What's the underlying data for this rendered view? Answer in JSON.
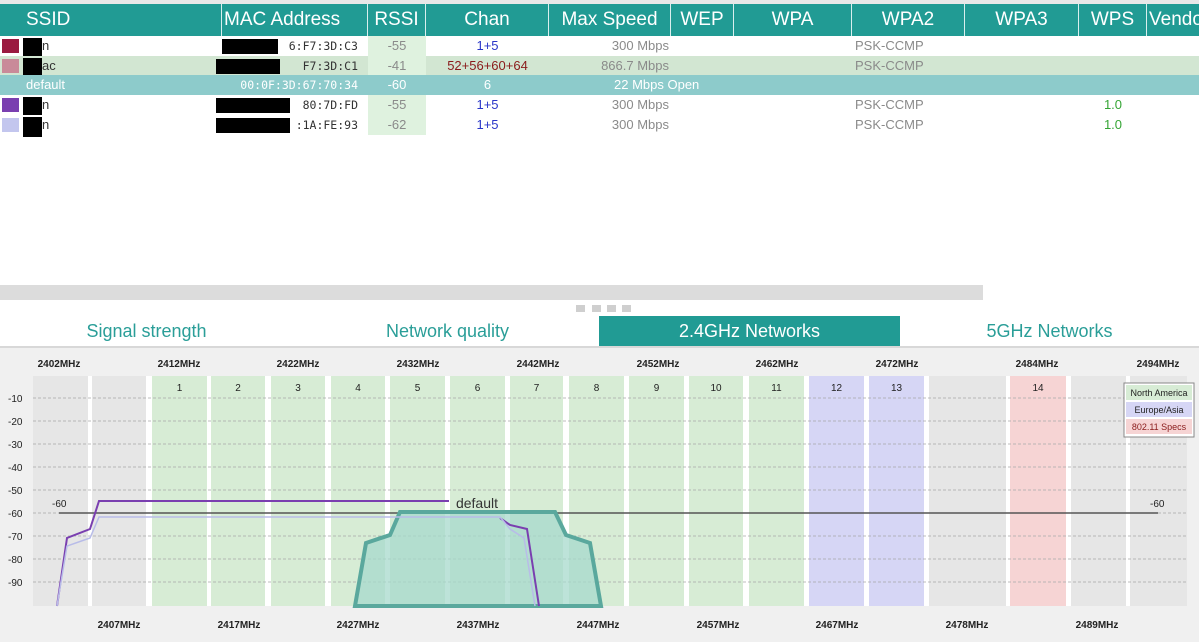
{
  "table": {
    "columns": [
      "SSID",
      "MAC Address",
      "RSSI",
      "Chan",
      "Max Speed",
      "WEP",
      "WPA",
      "WPA2",
      "WPA3",
      "WPS",
      "Vendor"
    ],
    "rows": [
      {
        "swatch": "#9a1a40",
        "ssid": "n",
        "mac": "6:F7:3D:C3",
        "rssi": "-55",
        "chan": "1+5",
        "speed": "300 Mbps",
        "wpa2": "PSK-CCMP",
        "wps": "",
        "redact": true,
        "bg": "#ffffff"
      },
      {
        "swatch": "#c98a99",
        "ssid": "ac",
        "mac": "F7:3D:C1",
        "rssi": "-41",
        "chan": "52+56+60+64",
        "speed": "866.7 Mbps",
        "wpa2": "PSK-CCMP",
        "wps": "",
        "redact": true,
        "bg": "#d2e6d2"
      },
      {
        "swatch": "",
        "ssid": "default",
        "mac": "00:0F:3D:67:70:34",
        "rssi": "-60",
        "chan": "6",
        "speed": "22 Mbps Open",
        "wpa2": "",
        "wps": "",
        "redact": false,
        "bg": "#8dcbcb"
      },
      {
        "swatch": "#7a3fb0",
        "ssid": "n",
        "mac": "80:7D:FD",
        "rssi": "-55",
        "chan": "1+5",
        "speed": "300 Mbps",
        "wpa2": "PSK-CCMP",
        "wps": "1.0",
        "redact": true,
        "bg": "#ffffff"
      },
      {
        "swatch": "#c3c6ee",
        "ssid": "n",
        "mac": ":1A:FE:93",
        "rssi": "-62",
        "chan": "1+5",
        "speed": "300 Mbps",
        "wpa2": "PSK-CCMP",
        "wps": "1.0",
        "redact": true,
        "bg": "#ffffff"
      }
    ]
  },
  "tabs": [
    {
      "label": "Signal strength",
      "active": false
    },
    {
      "label": "Network quality",
      "active": false
    },
    {
      "label": "2.4GHz Networks",
      "active": true
    },
    {
      "label": "5GHz Networks",
      "active": false
    }
  ],
  "chart_data": {
    "type": "spectrum",
    "top_freq_labels": [
      "2402MHz",
      "2412MHz",
      "2422MHz",
      "2432MHz",
      "2442MHz",
      "2452MHz",
      "2462MHz",
      "2472MHz",
      "2484MHz",
      "2494MHz"
    ],
    "bottom_freq_labels": [
      "2407MHz",
      "2417MHz",
      "2427MHz",
      "2437MHz",
      "2447MHz",
      "2457MHz",
      "2467MHz",
      "2478MHz",
      "2489MHz"
    ],
    "y_ticks": [
      -10,
      -20,
      -30,
      -40,
      -50,
      -60,
      -70,
      -80,
      -90
    ],
    "channels": [
      {
        "num": "1",
        "region": "na"
      },
      {
        "num": "2",
        "region": "na"
      },
      {
        "num": "3",
        "region": "na"
      },
      {
        "num": "4",
        "region": "na"
      },
      {
        "num": "5",
        "region": "na"
      },
      {
        "num": "6",
        "region": "na"
      },
      {
        "num": "7",
        "region": "na"
      },
      {
        "num": "8",
        "region": "na"
      },
      {
        "num": "9",
        "region": "na"
      },
      {
        "num": "10",
        "region": "na"
      },
      {
        "num": "11",
        "region": "na"
      },
      {
        "num": "12",
        "region": "eu"
      },
      {
        "num": "13",
        "region": "eu"
      },
      {
        "num": "14",
        "region": "spec"
      }
    ],
    "legend": [
      {
        "label": "North America",
        "color": "#d7ecd5"
      },
      {
        "label": "Europe/Asia",
        "color": "#d6d6f5"
      },
      {
        "label": "802.11 Specs",
        "color": "#f6d4d4"
      }
    ],
    "threshold": {
      "value": -60,
      "label_left": "-60",
      "label_right": "-60"
    },
    "networks": [
      {
        "name": "default",
        "rssi": -60,
        "from_mhz": 2426,
        "to_mhz": 2448,
        "color": "#5aa89d",
        "fill": "#a7d9cc",
        "label": "default"
      },
      {
        "name": "n",
        "rssi": -55,
        "from_mhz": 2402,
        "to_mhz": 2442,
        "color": "#7a3fb0",
        "fill": "none",
        "label": ""
      },
      {
        "name": "n",
        "rssi": -62,
        "from_mhz": 2402,
        "to_mhz": 2442,
        "color": "#b8bce8",
        "fill": "none",
        "label": ""
      }
    ],
    "ylim": [
      -100,
      0
    ],
    "xlim_mhz": [
      2400,
      2496
    ]
  }
}
